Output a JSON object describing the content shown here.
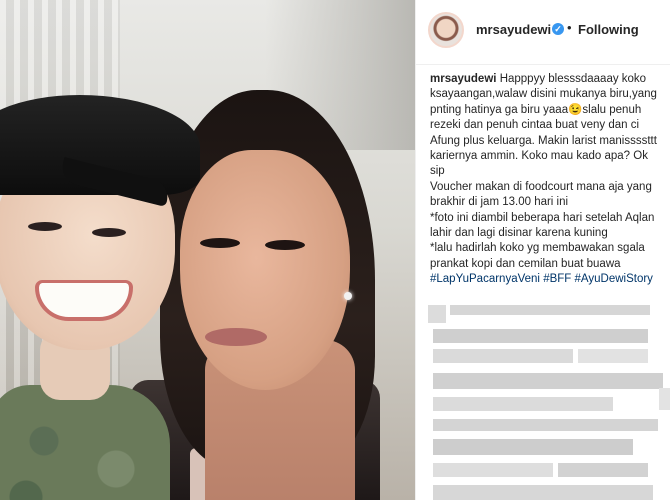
{
  "post": {
    "username": "mrsayudewi",
    "verified": true,
    "separator": "•",
    "follow_status": "Following"
  },
  "caption": {
    "username": "mrsayudewi",
    "text": "Happpyy blesssdaaaay koko ksayaangan,walaw disini mukanya biru,yang pnting hatinya ga biru yaaa😉slalu penuh rezeki dan penuh cintaa buat veny dan ci Afung plus keluarga. Makin larist manissssttt kariernya ammin. Koko mau kado apa? Ok sip\nVoucher makan di foodcourt mana aja yang brakhir di jam 13.00 hari ini\n*foto ini diambil beberapa hari setelah Aqlan lahir dan lagi disinar karena kuning\n*lalu hadirlah koko yg membawakan sgala prankat kopi dan cemilan buat buawa ",
    "hashtags": [
      "#LapYuPacarnyaVeni",
      "#BFF",
      "#AyuDewiStory"
    ]
  },
  "icons": {
    "avatar": "profile-avatar",
    "verified": "verified-badge-icon"
  },
  "colors": {
    "text": "#262626",
    "hashtag": "#003569",
    "verified": "#3897f0",
    "divider": "#efefef"
  }
}
